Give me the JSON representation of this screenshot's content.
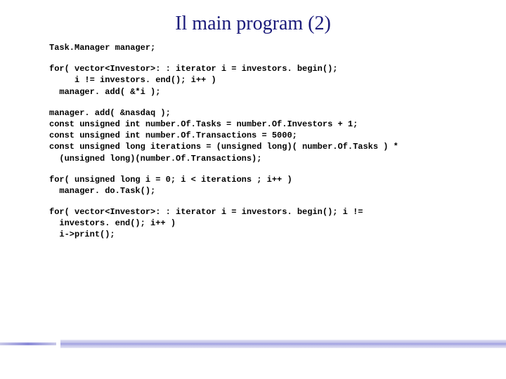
{
  "title": "Il main program (2)",
  "code": {
    "block1": "Task.Manager manager;",
    "block2": "for( vector<Investor>: : iterator i = investors. begin();\n     i != investors. end(); i++ )\n  manager. add( &*i );",
    "block3": "manager. add( &nasdaq );\nconst unsigned int number.Of.Tasks = number.Of.Investors + 1;\nconst unsigned int number.Of.Transactions = 5000;\nconst unsigned long iterations = (unsigned long)( number.Of.Tasks ) *\n  (unsigned long)(number.Of.Transactions);",
    "block4": "for( unsigned long i = 0; i < iterations ; i++ )\n  manager. do.Task();",
    "block5": "for( vector<Investor>: : iterator i = investors. begin(); i !=\n  investors. end(); i++ )\n  i->print();"
  }
}
